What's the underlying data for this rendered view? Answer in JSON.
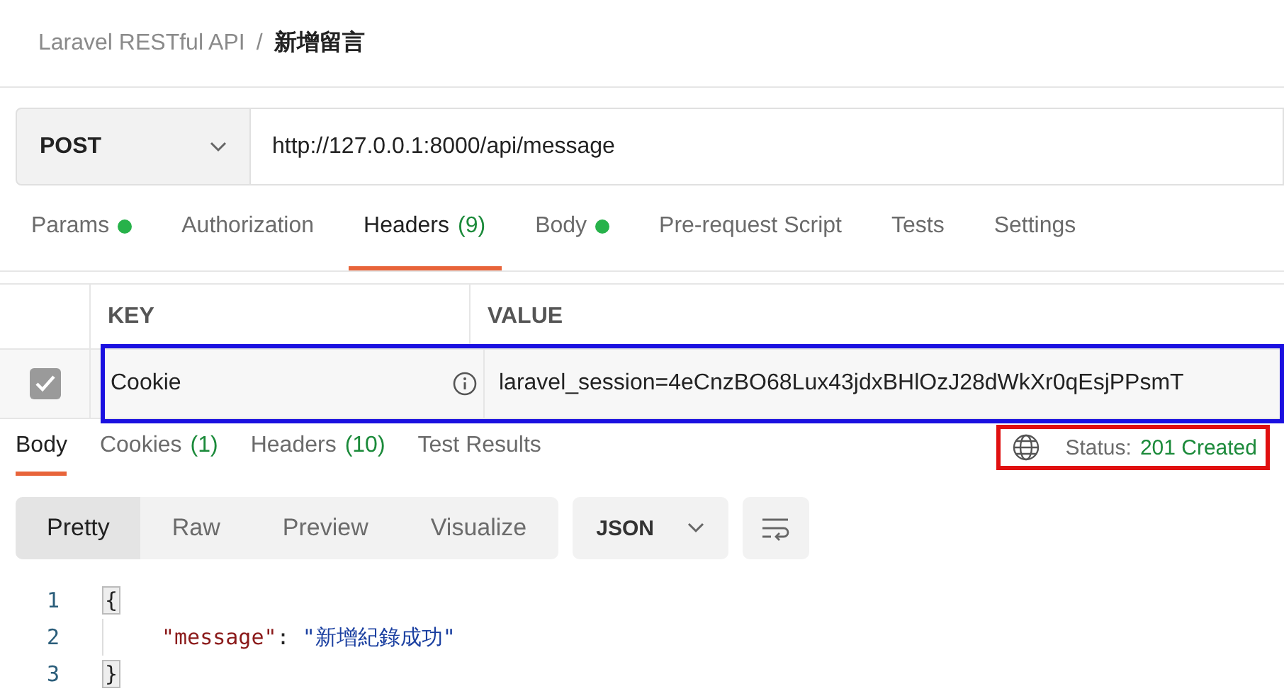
{
  "breadcrumb": {
    "collection": "Laravel RESTful API",
    "separator": "/",
    "request": "新增留言"
  },
  "request": {
    "method": "POST",
    "url": "http://127.0.0.1:8000/api/message"
  },
  "request_tabs": [
    {
      "label": "Params",
      "dot": true,
      "selected": false
    },
    {
      "label": "Authorization",
      "dot": false,
      "selected": false
    },
    {
      "label": "Headers",
      "count": "(9)",
      "dot": false,
      "selected": true
    },
    {
      "label": "Body",
      "dot": true,
      "selected": false
    },
    {
      "label": "Pre-request Script",
      "dot": false,
      "selected": false
    },
    {
      "label": "Tests",
      "dot": false,
      "selected": false
    },
    {
      "label": "Settings",
      "dot": false,
      "selected": false
    }
  ],
  "headers_table": {
    "columns": [
      "KEY",
      "VALUE"
    ],
    "rows": [
      {
        "checked": true,
        "key": "Cookie",
        "value": "laravel_session=4eCnzBO68Lux43jdxBHlOzJ28dWkXr0qEsjPPsmT",
        "highlighted": true
      }
    ]
  },
  "response_tabs": [
    {
      "label": "Body",
      "selected": true
    },
    {
      "label": "Cookies",
      "count": "(1)",
      "selected": false
    },
    {
      "label": "Headers",
      "count": "(10)",
      "selected": false
    },
    {
      "label": "Test Results",
      "selected": false
    }
  ],
  "status": {
    "label": "Status:",
    "value": "201 Created",
    "highlighted": true
  },
  "view_modes": [
    {
      "label": "Pretty",
      "selected": true
    },
    {
      "label": "Raw",
      "selected": false
    },
    {
      "label": "Preview",
      "selected": false
    },
    {
      "label": "Visualize",
      "selected": false
    }
  ],
  "format": "JSON",
  "code": [
    {
      "number": "1",
      "text": "{",
      "kind": "brace"
    },
    {
      "number": "2",
      "key": "\"message\"",
      "colon": ":",
      "value": "\"新增紀錄成功\"",
      "kind": "pair"
    },
    {
      "number": "3",
      "text": "}",
      "kind": "brace"
    }
  ]
}
